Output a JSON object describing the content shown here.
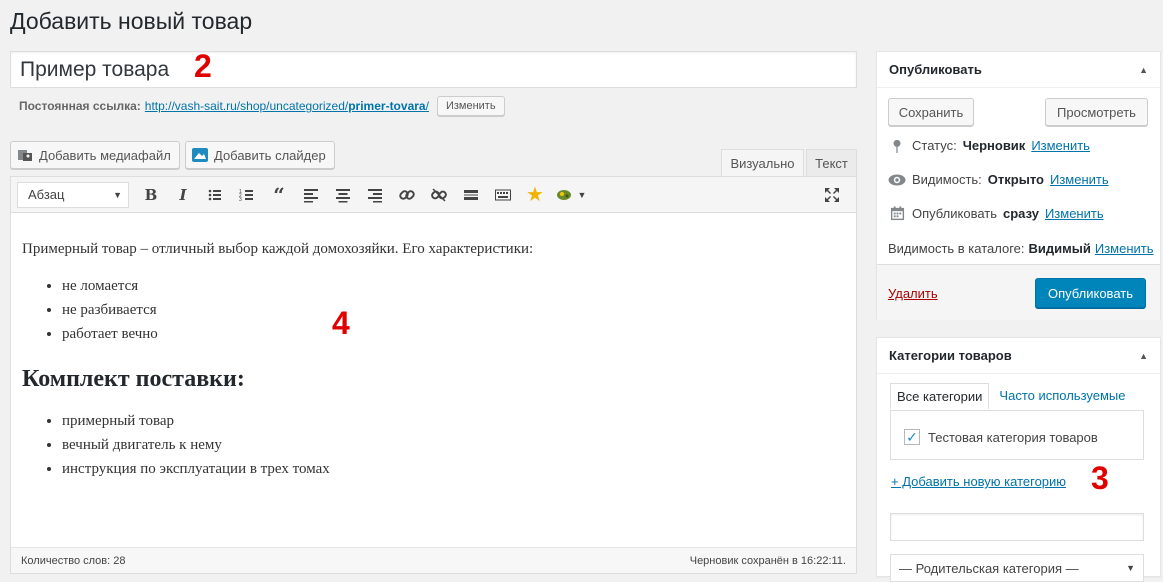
{
  "page": {
    "title": "Добавить новый товар"
  },
  "post": {
    "title": "Пример товара",
    "permalink_label": "Постоянная ссылка:",
    "permalink_base": "http://vash-sait.ru/shop/uncategorized/",
    "permalink_slug": "primer-tovara",
    "permalink_trail": "/",
    "edit_slug_button": "Изменить"
  },
  "annotations": {
    "title_marker": "2",
    "content_marker": "4",
    "category_marker": "3"
  },
  "editor": {
    "add_media": "Добавить медиафайл",
    "add_slider": "Добавить слайдер",
    "tab_visual": "Визуально",
    "tab_text": "Текст",
    "format_select": "Абзац",
    "toolbar_icons": [
      "bold-icon",
      "italic-icon",
      "bullet-list-icon",
      "numbered-list-icon",
      "blockquote-icon",
      "align-left-icon",
      "align-center-icon",
      "align-right-icon",
      "link-icon",
      "unlink-icon",
      "read-more-icon",
      "toolbar-toggle-icon",
      "star-icon",
      "plugin-icon",
      "expand-icon"
    ],
    "content": {
      "intro": "Примерный товар – отличный выбор каждой домохозяйки. Его характеристики:",
      "features": [
        "не ломается",
        "не разбивается",
        "работает вечно"
      ],
      "heading": "Комплект поставки:",
      "package": [
        "примерный товар",
        "вечный двигатель к нему",
        "инструкция по эксплуатации в трех томах"
      ]
    },
    "word_count": "Количество слов: 28",
    "autosave": "Черновик сохранён в 16:22:11."
  },
  "publish": {
    "title": "Опубликовать",
    "save_draft": "Сохранить",
    "preview": "Просмотреть",
    "status_label": "Статус:",
    "status_value": "Черновик",
    "visibility_label": "Видимость:",
    "visibility_value": "Открыто",
    "publish_label": "Опубликовать",
    "publish_value": "сразу",
    "catalog_label": "Видимость в каталоге:",
    "catalog_value": "Видимый",
    "edit_link": "Изменить",
    "delete": "Удалить",
    "publish_button": "Опубликовать"
  },
  "categories": {
    "title": "Категории товаров",
    "tab_all": "Все категории",
    "tab_popular": "Часто используемые",
    "items": [
      {
        "label": "Тестовая категория товаров",
        "checked": true
      }
    ],
    "add_new": "+ Добавить новую категорию",
    "parent_select": "— Родительская категория —"
  },
  "colors": {
    "primary_button": "#0085ba",
    "link": "#0073aa",
    "delete": "#a00000",
    "annotation": "#e00000"
  }
}
